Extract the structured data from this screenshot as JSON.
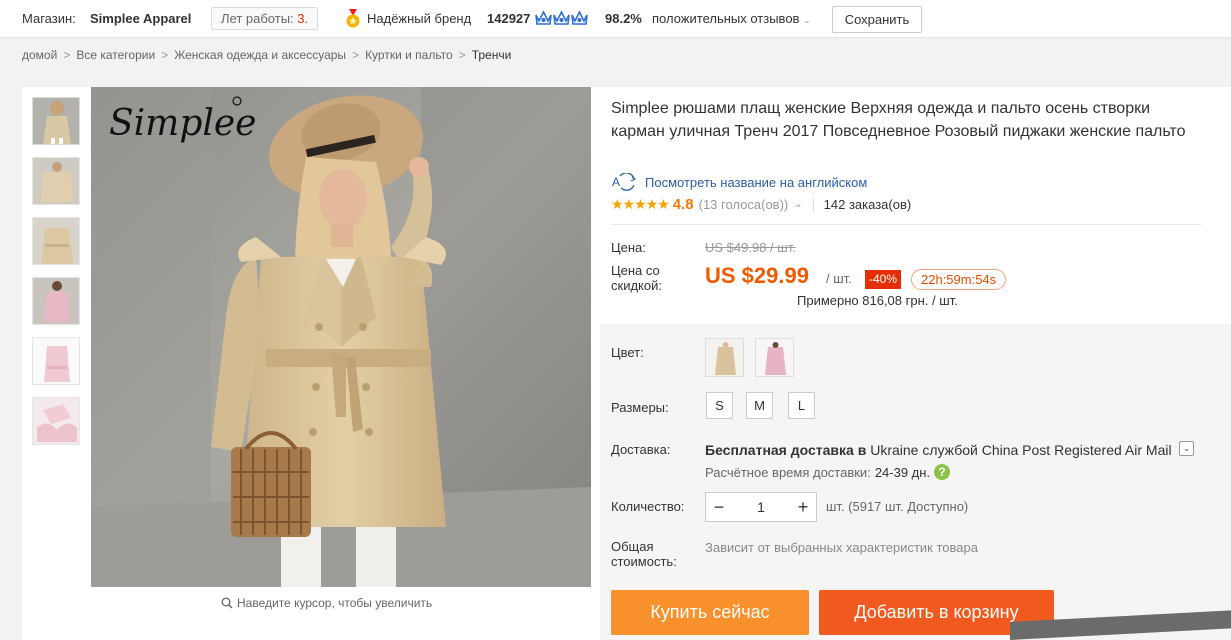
{
  "store": {
    "label": "Магазин:",
    "name": "Simplee Apparel",
    "years_label": "Лет работы:",
    "years_value": "3",
    "years_dot": ".",
    "brand_label": "Надёжный бренд",
    "score": "142927",
    "positive_pct": "98.2%",
    "positive_label": "положительных отзывов",
    "save_label": "Сохранить"
  },
  "breadcrumb": [
    "домой",
    "Все категории",
    "Женская одежда и аксессуары",
    "Куртки и пальто",
    "Тренчи"
  ],
  "breadcrumb_sep": ">",
  "gallery": {
    "thumbs": [
      "thumb-1",
      "thumb-2",
      "thumb-3",
      "thumb-4",
      "thumb-5",
      "thumb-6"
    ],
    "logo_text": "Simplee",
    "zoom_hint": "Наведите курсор, чтобы увеличить"
  },
  "product": {
    "title": "Simplee рюшами плащ женские Верхняя одежда и пальто осень створки карман уличная Тренч 2017 Повседневное Розовый пиджаки женские пальто",
    "english_link": "Посмотреть название на английском",
    "stars": "★★★★★",
    "rating": "4.8",
    "votes": "(13 голоса(ов))",
    "orders": "142 заказа(ов)"
  },
  "price": {
    "price_label": "Цена:",
    "old_price": "US $49.98 / шт.",
    "discount_label": "Цена со скидкой:",
    "new_price": "US $29.99",
    "per_unit": "/ шт.",
    "discount": "-40%",
    "timer": "22h:59m:54s",
    "approx": "Примерно 816,08 грн. / шт."
  },
  "sku": {
    "color_label": "Цвет:",
    "colors": [
      "khaki",
      "pink"
    ],
    "size_label": "Размеры:",
    "sizes": [
      "S",
      "M",
      "L"
    ],
    "shipping_label": "Доставка:",
    "shipping_free": "Бесплатная доставка в",
    "shipping_rest": "Ukraine службой China Post Registered Air Mail",
    "delivery_label": "Расчётное время доставки:",
    "delivery_days": "24-39 дн.",
    "help": "?",
    "qty_label": "Количество:",
    "qty_minus": "−",
    "qty_value": "1",
    "qty_plus": "+",
    "available": "шт. (5917 шт. Доступно)",
    "total_label": "Общая стоимость:",
    "total_value": "Зависит от выбранных характеристик товара"
  },
  "actions": {
    "buy": "Купить сейчас",
    "cart": "Добавить в корзину"
  },
  "colors": {
    "accent_orange": "#f05a00",
    "buy_btn": "#f8902b",
    "cart_btn": "#f05a1e",
    "link": "#2a5ea8",
    "discount_bg": "#e62e04"
  }
}
